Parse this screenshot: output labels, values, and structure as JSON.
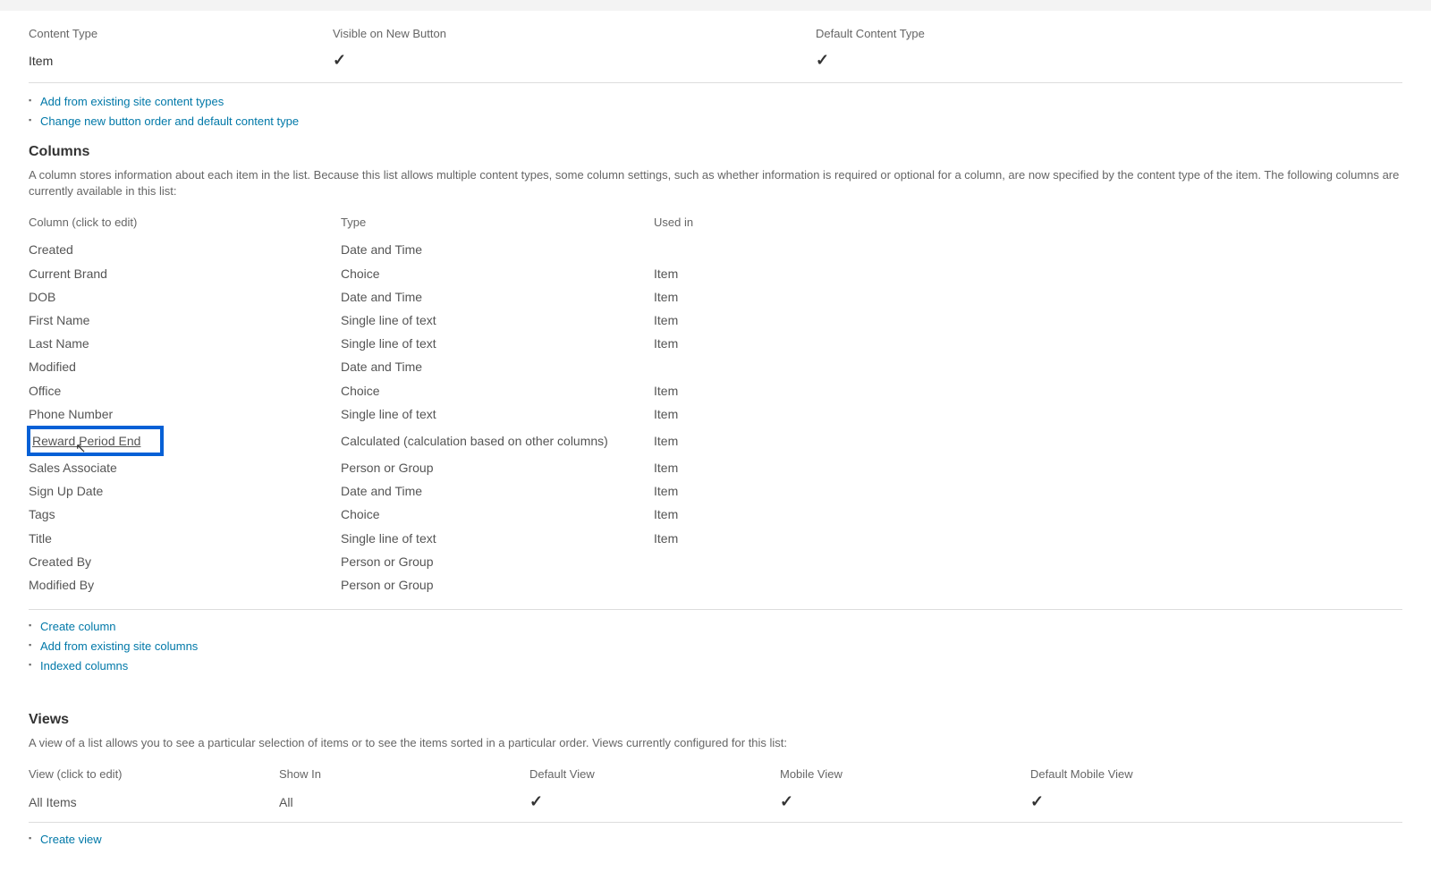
{
  "contentTypes": {
    "headers": {
      "contentType": "Content Type",
      "visibleOnNew": "Visible on New Button",
      "defaultCT": "Default Content Type"
    },
    "rows": [
      {
        "name": "Item",
        "visibleOnNew": "✓",
        "default": "✓"
      }
    ],
    "links": {
      "addExisting": "Add from existing site content types",
      "changeOrder": "Change new button order and default content type"
    }
  },
  "columnsSection": {
    "heading": "Columns",
    "description": "A column stores information about each item in the list. Because this list allows multiple content types, some column settings, such as whether information is required or optional for a column, are now specified by the content type of the item. The following columns are currently available in this list:",
    "headers": {
      "column": "Column (click to edit)",
      "type": "Type",
      "usedIn": "Used in"
    },
    "columns": [
      {
        "name": "Created",
        "type": "Date and Time",
        "usedIn": ""
      },
      {
        "name": "Current Brand",
        "type": "Choice",
        "usedIn": "Item"
      },
      {
        "name": "DOB",
        "type": "Date and Time",
        "usedIn": "Item"
      },
      {
        "name": "First Name",
        "type": "Single line of text",
        "usedIn": "Item"
      },
      {
        "name": "Last Name",
        "type": "Single line of text",
        "usedIn": "Item"
      },
      {
        "name": "Modified",
        "type": "Date and Time",
        "usedIn": ""
      },
      {
        "name": "Office",
        "type": "Choice",
        "usedIn": "Item"
      },
      {
        "name": "Phone Number",
        "type": "Single line of text",
        "usedIn": "Item"
      },
      {
        "name": "Reward Period End",
        "type": "Calculated (calculation based on other columns)",
        "usedIn": "Item",
        "highlighted": true
      },
      {
        "name": "Sales Associate",
        "type": "Person or Group",
        "usedIn": "Item"
      },
      {
        "name": "Sign Up Date",
        "type": "Date and Time",
        "usedIn": "Item"
      },
      {
        "name": "Tags",
        "type": "Choice",
        "usedIn": "Item"
      },
      {
        "name": "Title",
        "type": "Single line of text",
        "usedIn": "Item"
      },
      {
        "name": "Created By",
        "type": "Person or Group",
        "usedIn": ""
      },
      {
        "name": "Modified By",
        "type": "Person or Group",
        "usedIn": ""
      }
    ],
    "links": {
      "createColumn": "Create column",
      "addFromExisting": "Add from existing site columns",
      "indexedColumns": "Indexed columns"
    }
  },
  "viewsSection": {
    "heading": "Views",
    "description": "A view of a list allows you to see a particular selection of items or to see the items sorted in a particular order. Views currently configured for this list:",
    "headers": {
      "view": "View (click to edit)",
      "showIn": "Show In",
      "defaultView": "Default View",
      "mobileView": "Mobile View",
      "defaultMobileView": "Default Mobile View"
    },
    "rows": [
      {
        "name": "All Items",
        "showIn": "All",
        "defaultView": "✓",
        "mobileView": "✓",
        "defaultMobileView": "✓"
      }
    ],
    "links": {
      "createView": "Create view"
    }
  }
}
